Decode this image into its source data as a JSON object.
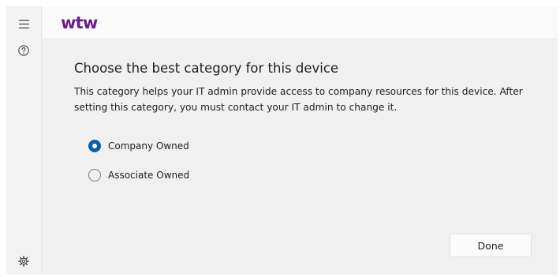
{
  "rail": {
    "menu_icon": "hamburger-menu-icon",
    "help_icon": "help-question-icon",
    "settings_icon": "gear-icon"
  },
  "header": {
    "logo_text": "wtw",
    "brand_color": "#6b1e86"
  },
  "content": {
    "title": "Choose the best category for this device",
    "description": "This category helps your IT admin provide access to company resources for this device. After setting this category, you must contact your IT admin to change it."
  },
  "options": [
    {
      "label": "Company Owned",
      "selected": true
    },
    {
      "label": "Associate Owned",
      "selected": false
    }
  ],
  "done_button": {
    "label": "Done"
  },
  "colors": {
    "radio_selected": "#0a5fa6"
  }
}
